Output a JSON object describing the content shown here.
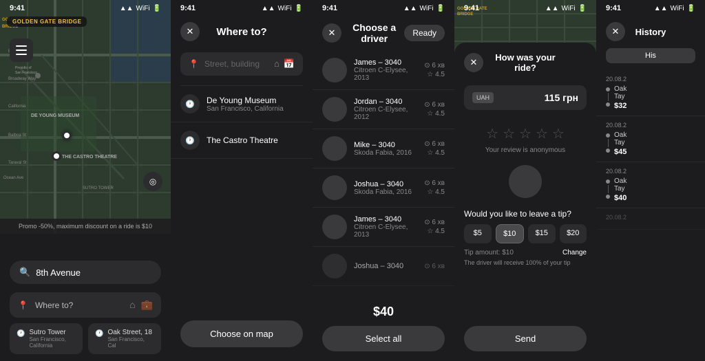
{
  "screen1": {
    "status_time": "9:41",
    "bridge_label": "GOLDEN GATE BRIDGE",
    "search_text": "8th Avenue",
    "where_placeholder": "Where to?",
    "promo_text": "Promo -50%, maximum discount on a ride is $10",
    "recent1_name": "Sutro Tower",
    "recent1_addr": "San Francisco, California",
    "recent2_name": "Oak Street, 18",
    "recent2_addr": "San Francisco, Cal"
  },
  "screen2": {
    "status_time": "9:41",
    "title": "Where to?",
    "input_placeholder": "Street, building",
    "history1_name": "De Young Museum",
    "history1_addr": "San Francisco, California",
    "history2_name": "The Castro Theatre",
    "btn_label": "Choose on map"
  },
  "screen3": {
    "status_time": "9:41",
    "title": "Choose a driver",
    "ready_label": "Ready",
    "drivers": [
      {
        "name": "James – 3040",
        "car": "Citroen C-Elysee, 2013",
        "dist": "⊙ 6 хв",
        "rating": "☆ 4.5"
      },
      {
        "name": "Jordan – 3040",
        "car": "Citroen C-Elysee, 2012",
        "dist": "⊙ 6 хв",
        "rating": "☆ 4.5"
      },
      {
        "name": "Mike – 3040",
        "car": "Skoda Fabia, 2016",
        "dist": "⊙ 6 хв",
        "rating": "☆ 4.5"
      },
      {
        "name": "Joshua – 3040",
        "car": "Skoda Fabia, 2016",
        "dist": "⊙ 6 хв",
        "rating": "☆ 4.5"
      },
      {
        "name": "James – 3040",
        "car": "Citroen C-Elysee, 2013",
        "dist": "⊙ 6 хв",
        "rating": "☆ 4.5"
      },
      {
        "name": "Joshua – 3040",
        "car": "",
        "dist": "⊙ 6 хв",
        "rating": ""
      }
    ],
    "price": "$40",
    "select_all_label": "Select all"
  },
  "screen4": {
    "status_time": "9:41",
    "bridge_label": "GOLDEN GATE BRIDGE",
    "title": "How was your ride?",
    "payment_label": "UAH",
    "price": "115 грн",
    "stars_note": "Your review is anonymous",
    "tip_title": "Would you like to leave a tip?",
    "tip_options": [
      "$5",
      "$10",
      "$15",
      "$20"
    ],
    "active_tip": "$10",
    "tip_amount_text": "Tip amount: $10",
    "tip_change_label": "Change",
    "tip_note": "The driver will receive 100% of your tip",
    "send_label": "Send",
    "history_entries": [
      {
        "date": "20.08.",
        "from": "Oak",
        "price": "$32"
      },
      {
        "date": "20.08.",
        "from": "Oak",
        "price": "$45"
      }
    ]
  },
  "screen5": {
    "status_time": "9:41",
    "tab_label": "His",
    "entries": [
      {
        "date": "20.08.2",
        "from": "Oak",
        "to": "Tay",
        "price": "$40"
      },
      {
        "date": "20.08.2",
        "from": "Oak",
        "to": "Tay",
        "price": "$32"
      },
      {
        "date": "20.08.2",
        "from": "Oak",
        "to": "Tay",
        "price": "$45"
      }
    ]
  }
}
